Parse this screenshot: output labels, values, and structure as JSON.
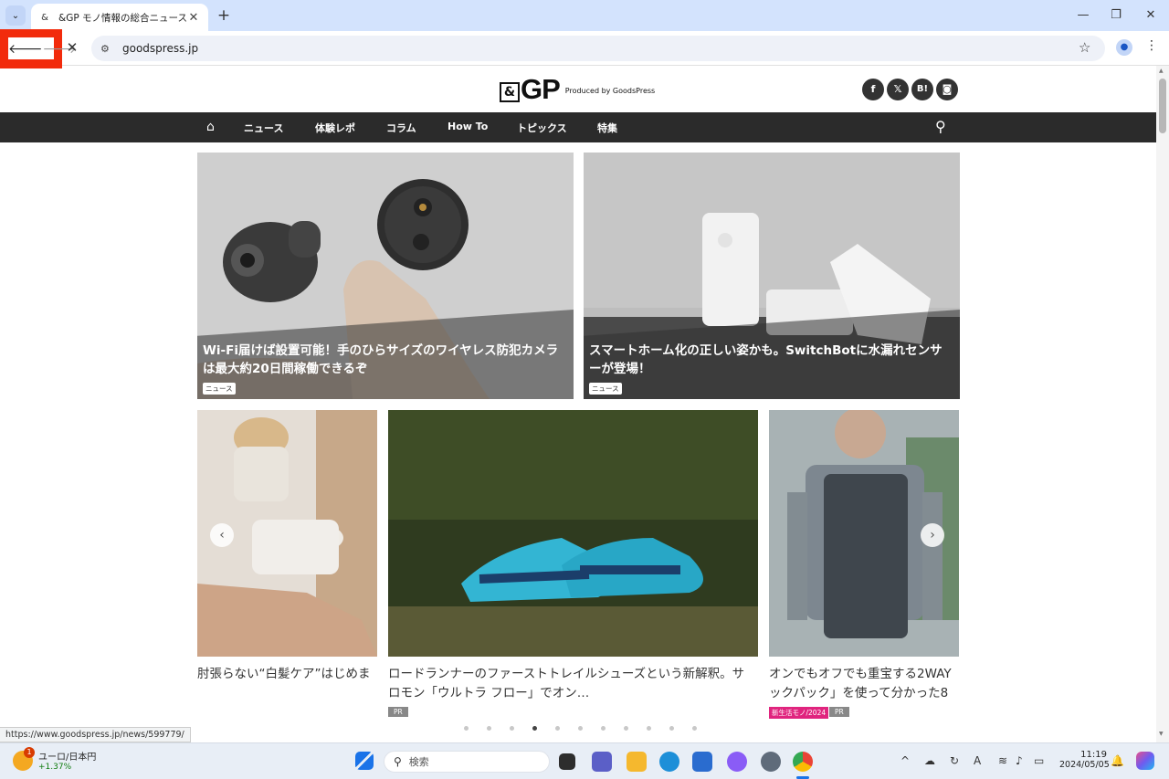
{
  "browser": {
    "tab_title": "&GP モノ情報の総合ニュースサイト",
    "tab_close": "✕",
    "new_tab": "+",
    "url": "goodspress.jp",
    "status_url": "https://www.goodspress.jp/news/599779/"
  },
  "site": {
    "logo_amp": "&",
    "logo_gp": "GP",
    "logo_sub": "Produced by GoodsPress",
    "social": [
      "f",
      "𝕏",
      "B!",
      "◙"
    ]
  },
  "nav": {
    "items": [
      "ニュース",
      "体験レポ",
      "コラム",
      "How To",
      "トピックス",
      "特集"
    ]
  },
  "features": [
    {
      "title": "Wi-Fi届けば設置可能！手のひらサイズのワイヤレス防犯カメラは最大約20日間稼働できるぞ",
      "tag": "ニュース"
    },
    {
      "title": "スマートホーム化の正しい姿かも。SwitchBotに水漏れセンサーが登場！",
      "tag": "ニュース"
    }
  ],
  "carousel": {
    "cards": [
      {
        "title_l1": "肘張らない“白髪ケア”はじめま",
        "title_l2": "",
        "badges": []
      },
      {
        "title_l1": "ロードランナーのファーストトレイルシューズという新解釈。サ",
        "title_l2": "ロモン「ウルトラ フロー」でオン…",
        "badges": [
          "PR"
        ]
      },
      {
        "title_l1": "オンでもオフでも重宝する2WAY",
        "title_l2": "ックパック」を使って分かった8",
        "badges": [
          "新生活モノ/2024",
          "PR"
        ]
      }
    ],
    "prev": "‹",
    "next": "›",
    "dot_count": 11,
    "active_dot": 3
  },
  "taskbar": {
    "weather_badge": "1",
    "weather_l1": "ユーロ/日本円",
    "weather_l2": "+1.37%",
    "search_placeholder": "検索",
    "time": "11:19",
    "date": "2024/05/05"
  },
  "colors": {
    "nav_bg": "#2b2b2b",
    "highlight": "#f22b0c",
    "pink_badge": "#e0247e",
    "pr_badge": "#888888"
  }
}
